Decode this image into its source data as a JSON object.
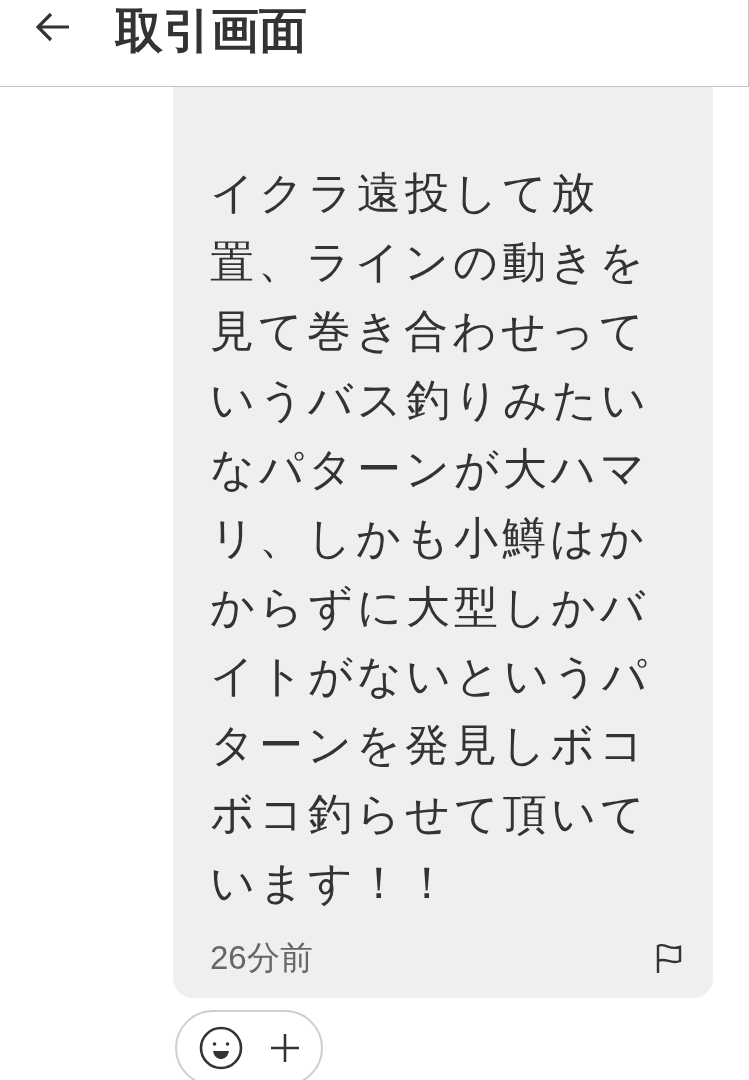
{
  "header": {
    "title": "取引画面"
  },
  "message": {
    "text": "イクラ遠投して放置、ラインの動きを見て巻き合わせっていうバス釣りみたいなパターンが大ハマリ、しかも小鱒はかからずに大型しかバイトがないというパターンを発見しボコボコ釣らせて頂いています！！",
    "time": "26分前"
  }
}
